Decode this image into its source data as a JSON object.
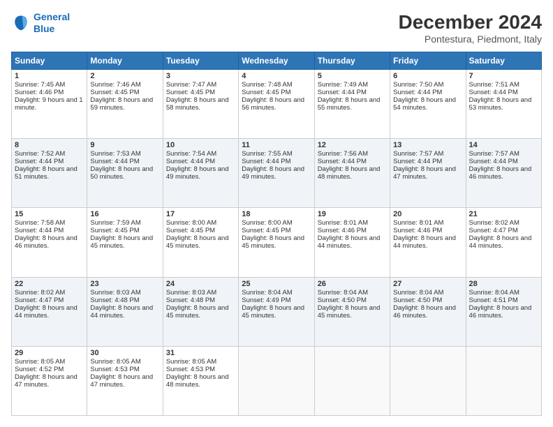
{
  "logo": {
    "line1": "General",
    "line2": "Blue"
  },
  "title": "December 2024",
  "subtitle": "Pontestura, Piedmont, Italy",
  "days_header": [
    "Sunday",
    "Monday",
    "Tuesday",
    "Wednesday",
    "Thursday",
    "Friday",
    "Saturday"
  ],
  "weeks": [
    [
      {
        "day": "1",
        "sunrise": "Sunrise: 7:45 AM",
        "sunset": "Sunset: 4:46 PM",
        "daylight": "Daylight: 9 hours and 1 minute."
      },
      {
        "day": "2",
        "sunrise": "Sunrise: 7:46 AM",
        "sunset": "Sunset: 4:45 PM",
        "daylight": "Daylight: 8 hours and 59 minutes."
      },
      {
        "day": "3",
        "sunrise": "Sunrise: 7:47 AM",
        "sunset": "Sunset: 4:45 PM",
        "daylight": "Daylight: 8 hours and 58 minutes."
      },
      {
        "day": "4",
        "sunrise": "Sunrise: 7:48 AM",
        "sunset": "Sunset: 4:45 PM",
        "daylight": "Daylight: 8 hours and 56 minutes."
      },
      {
        "day": "5",
        "sunrise": "Sunrise: 7:49 AM",
        "sunset": "Sunset: 4:44 PM",
        "daylight": "Daylight: 8 hours and 55 minutes."
      },
      {
        "day": "6",
        "sunrise": "Sunrise: 7:50 AM",
        "sunset": "Sunset: 4:44 PM",
        "daylight": "Daylight: 8 hours and 54 minutes."
      },
      {
        "day": "7",
        "sunrise": "Sunrise: 7:51 AM",
        "sunset": "Sunset: 4:44 PM",
        "daylight": "Daylight: 8 hours and 53 minutes."
      }
    ],
    [
      {
        "day": "8",
        "sunrise": "Sunrise: 7:52 AM",
        "sunset": "Sunset: 4:44 PM",
        "daylight": "Daylight: 8 hours and 51 minutes."
      },
      {
        "day": "9",
        "sunrise": "Sunrise: 7:53 AM",
        "sunset": "Sunset: 4:44 PM",
        "daylight": "Daylight: 8 hours and 50 minutes."
      },
      {
        "day": "10",
        "sunrise": "Sunrise: 7:54 AM",
        "sunset": "Sunset: 4:44 PM",
        "daylight": "Daylight: 8 hours and 49 minutes."
      },
      {
        "day": "11",
        "sunrise": "Sunrise: 7:55 AM",
        "sunset": "Sunset: 4:44 PM",
        "daylight": "Daylight: 8 hours and 49 minutes."
      },
      {
        "day": "12",
        "sunrise": "Sunrise: 7:56 AM",
        "sunset": "Sunset: 4:44 PM",
        "daylight": "Daylight: 8 hours and 48 minutes."
      },
      {
        "day": "13",
        "sunrise": "Sunrise: 7:57 AM",
        "sunset": "Sunset: 4:44 PM",
        "daylight": "Daylight: 8 hours and 47 minutes."
      },
      {
        "day": "14",
        "sunrise": "Sunrise: 7:57 AM",
        "sunset": "Sunset: 4:44 PM",
        "daylight": "Daylight: 8 hours and 46 minutes."
      }
    ],
    [
      {
        "day": "15",
        "sunrise": "Sunrise: 7:58 AM",
        "sunset": "Sunset: 4:44 PM",
        "daylight": "Daylight: 8 hours and 46 minutes."
      },
      {
        "day": "16",
        "sunrise": "Sunrise: 7:59 AM",
        "sunset": "Sunset: 4:45 PM",
        "daylight": "Daylight: 8 hours and 45 minutes."
      },
      {
        "day": "17",
        "sunrise": "Sunrise: 8:00 AM",
        "sunset": "Sunset: 4:45 PM",
        "daylight": "Daylight: 8 hours and 45 minutes."
      },
      {
        "day": "18",
        "sunrise": "Sunrise: 8:00 AM",
        "sunset": "Sunset: 4:45 PM",
        "daylight": "Daylight: 8 hours and 45 minutes."
      },
      {
        "day": "19",
        "sunrise": "Sunrise: 8:01 AM",
        "sunset": "Sunset: 4:46 PM",
        "daylight": "Daylight: 8 hours and 44 minutes."
      },
      {
        "day": "20",
        "sunrise": "Sunrise: 8:01 AM",
        "sunset": "Sunset: 4:46 PM",
        "daylight": "Daylight: 8 hours and 44 minutes."
      },
      {
        "day": "21",
        "sunrise": "Sunrise: 8:02 AM",
        "sunset": "Sunset: 4:47 PM",
        "daylight": "Daylight: 8 hours and 44 minutes."
      }
    ],
    [
      {
        "day": "22",
        "sunrise": "Sunrise: 8:02 AM",
        "sunset": "Sunset: 4:47 PM",
        "daylight": "Daylight: 8 hours and 44 minutes."
      },
      {
        "day": "23",
        "sunrise": "Sunrise: 8:03 AM",
        "sunset": "Sunset: 4:48 PM",
        "daylight": "Daylight: 8 hours and 44 minutes."
      },
      {
        "day": "24",
        "sunrise": "Sunrise: 8:03 AM",
        "sunset": "Sunset: 4:48 PM",
        "daylight": "Daylight: 8 hours and 45 minutes."
      },
      {
        "day": "25",
        "sunrise": "Sunrise: 8:04 AM",
        "sunset": "Sunset: 4:49 PM",
        "daylight": "Daylight: 8 hours and 45 minutes."
      },
      {
        "day": "26",
        "sunrise": "Sunrise: 8:04 AM",
        "sunset": "Sunset: 4:50 PM",
        "daylight": "Daylight: 8 hours and 45 minutes."
      },
      {
        "day": "27",
        "sunrise": "Sunrise: 8:04 AM",
        "sunset": "Sunset: 4:50 PM",
        "daylight": "Daylight: 8 hours and 46 minutes."
      },
      {
        "day": "28",
        "sunrise": "Sunrise: 8:04 AM",
        "sunset": "Sunset: 4:51 PM",
        "daylight": "Daylight: 8 hours and 46 minutes."
      }
    ],
    [
      {
        "day": "29",
        "sunrise": "Sunrise: 8:05 AM",
        "sunset": "Sunset: 4:52 PM",
        "daylight": "Daylight: 8 hours and 47 minutes."
      },
      {
        "day": "30",
        "sunrise": "Sunrise: 8:05 AM",
        "sunset": "Sunset: 4:53 PM",
        "daylight": "Daylight: 8 hours and 47 minutes."
      },
      {
        "day": "31",
        "sunrise": "Sunrise: 8:05 AM",
        "sunset": "Sunset: 4:53 PM",
        "daylight": "Daylight: 8 hours and 48 minutes."
      },
      null,
      null,
      null,
      null
    ]
  ]
}
